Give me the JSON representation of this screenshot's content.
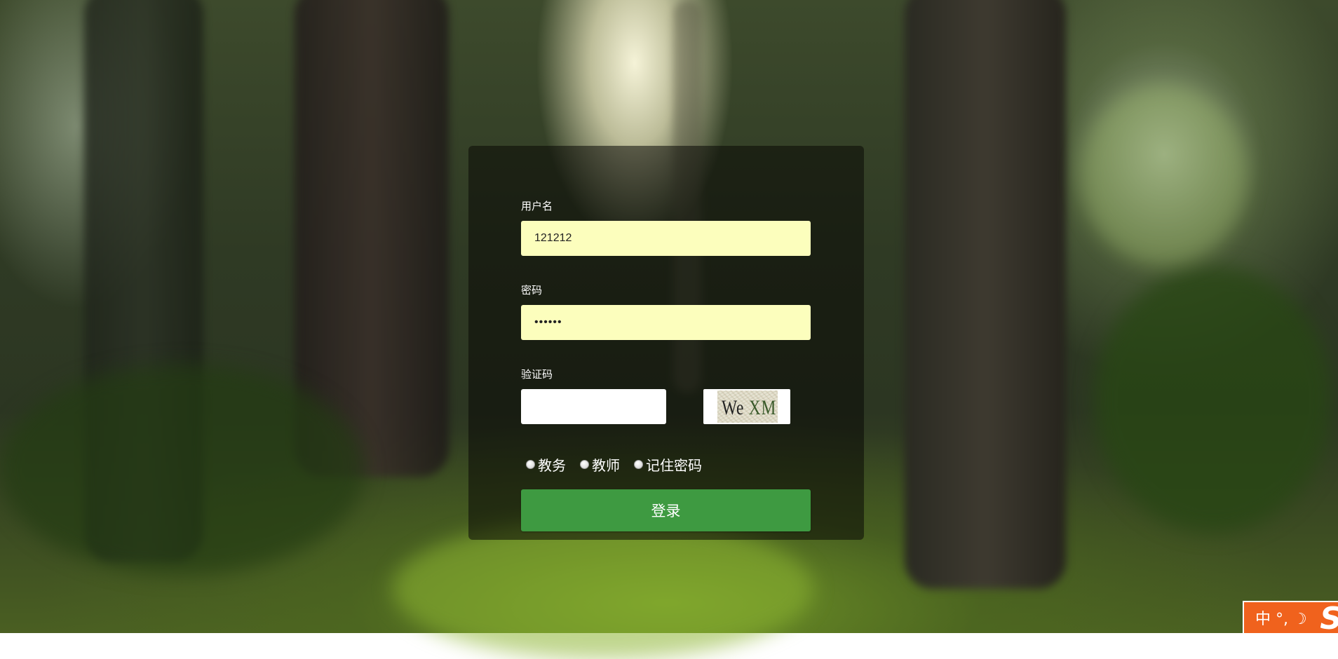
{
  "login": {
    "username_label": "用户名",
    "username_value": "121212",
    "password_label": "密码",
    "password_value": "••••••",
    "captcha_label": "验证码",
    "captcha_value": "",
    "captcha_image_part1": "We",
    "captcha_image_part2": " XM",
    "roles": [
      {
        "label": "教务",
        "checked": false
      },
      {
        "label": "教师",
        "checked": false
      }
    ],
    "remember_label": "记住密码",
    "submit_label": "登录"
  },
  "ime": {
    "indicator_text": "中 °, ☽",
    "logo_letter": "S"
  },
  "colors": {
    "input_autofill_bg": "#fcfebd",
    "button_green": "#3e9a41",
    "ime_orange": "#f0621d"
  }
}
